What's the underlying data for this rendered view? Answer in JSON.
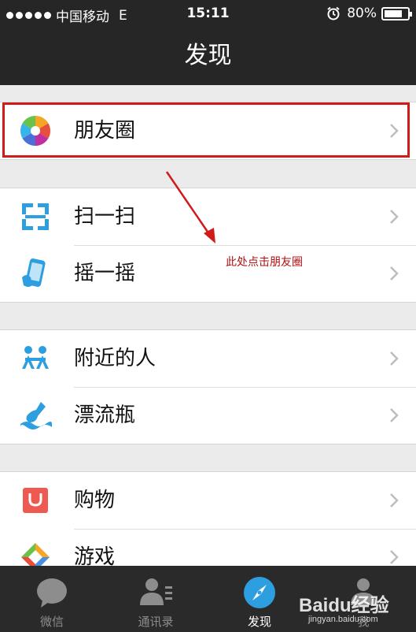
{
  "status_bar": {
    "carrier": "中国移动",
    "network": "E",
    "time": "15:11",
    "battery": "80%",
    "battery_level": 0.8
  },
  "nav": {
    "title": "发现"
  },
  "groups": [
    [
      {
        "label": "朋友圈",
        "icon": "moments-icon"
      }
    ],
    [
      {
        "label": "扫一扫",
        "icon": "scan-icon"
      },
      {
        "label": "摇一摇",
        "icon": "shake-icon"
      }
    ],
    [
      {
        "label": "附近的人",
        "icon": "people-nearby-icon"
      },
      {
        "label": "漂流瓶",
        "icon": "drift-bottle-icon"
      }
    ],
    [
      {
        "label": "购物",
        "icon": "shopping-icon"
      },
      {
        "label": "游戏",
        "icon": "games-icon"
      }
    ]
  ],
  "annotation": "此处点击朋友圈",
  "tabs": [
    {
      "label": "微信",
      "icon": "chat-bubble-icon",
      "active": false
    },
    {
      "label": "通讯录",
      "icon": "contacts-icon",
      "active": false
    },
    {
      "label": "发现",
      "icon": "compass-icon",
      "active": true
    },
    {
      "label": "我",
      "icon": "person-icon",
      "active": false
    }
  ],
  "watermark": {
    "brand": "Baidu经验",
    "url": "jingyan.baidu.com"
  }
}
